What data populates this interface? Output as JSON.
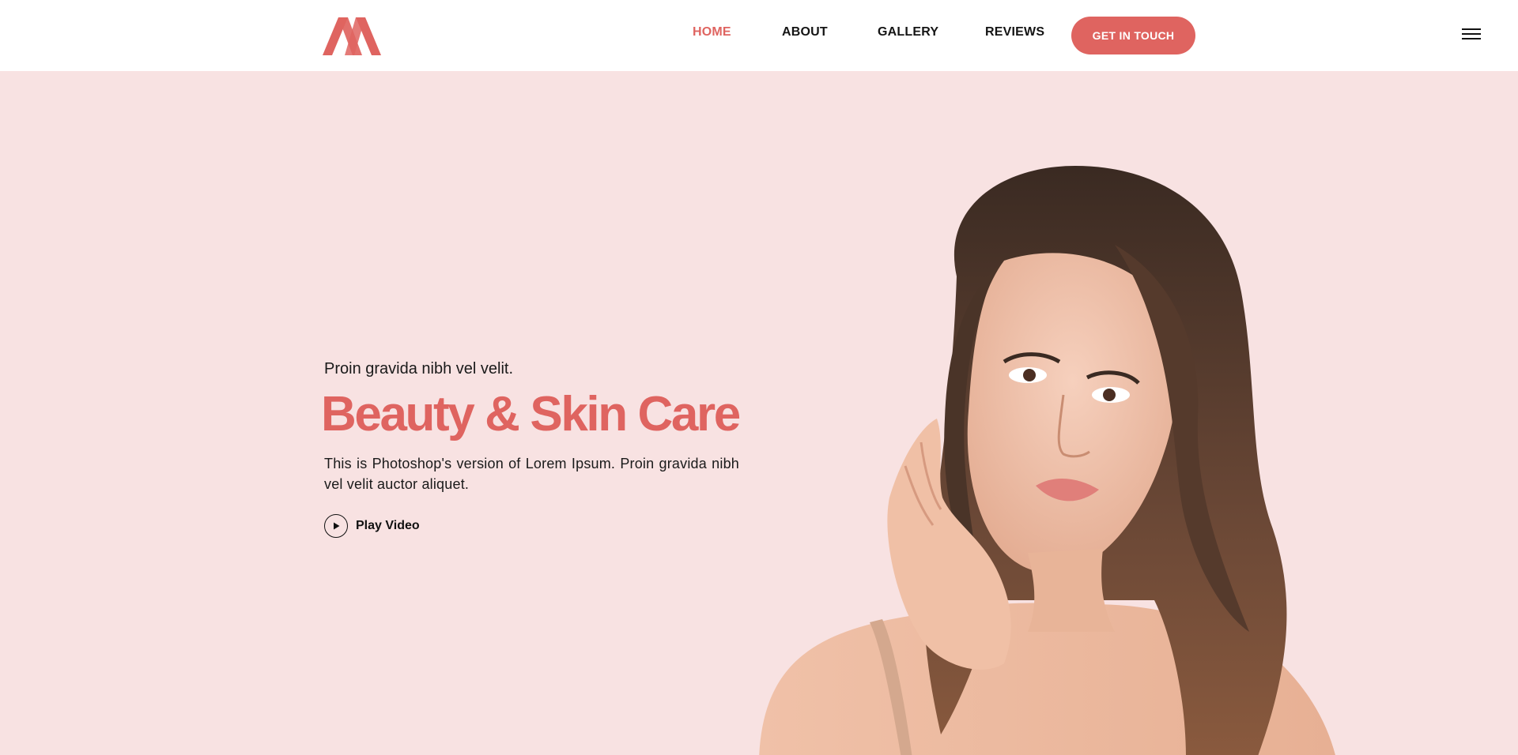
{
  "header": {
    "logo_icon": "m-monogram-logo",
    "nav": [
      {
        "label": "HOME",
        "active": true
      },
      {
        "label": "ABOUT",
        "active": false
      },
      {
        "label": "GALLERY",
        "active": false
      },
      {
        "label": "REVIEWS",
        "active": false
      }
    ],
    "cta_label": "GET IN TOUCH",
    "menu_icon": "hamburger-menu-icon"
  },
  "hero": {
    "subtitle": "Proin gravida nibh vel velit.",
    "headline": "Beauty & Skin Care",
    "description": "This is Photoshop's version of Lorem Ipsum. Proin gravida nibh vel velit auctor aliquet.",
    "play_label": "Play Video",
    "play_icon": "play-icon",
    "image": "woman-portrait-photo"
  },
  "colors": {
    "accent": "#df6460",
    "hero_background": "#f8e2e2",
    "header_background": "#ffffff",
    "text": "#111111"
  }
}
